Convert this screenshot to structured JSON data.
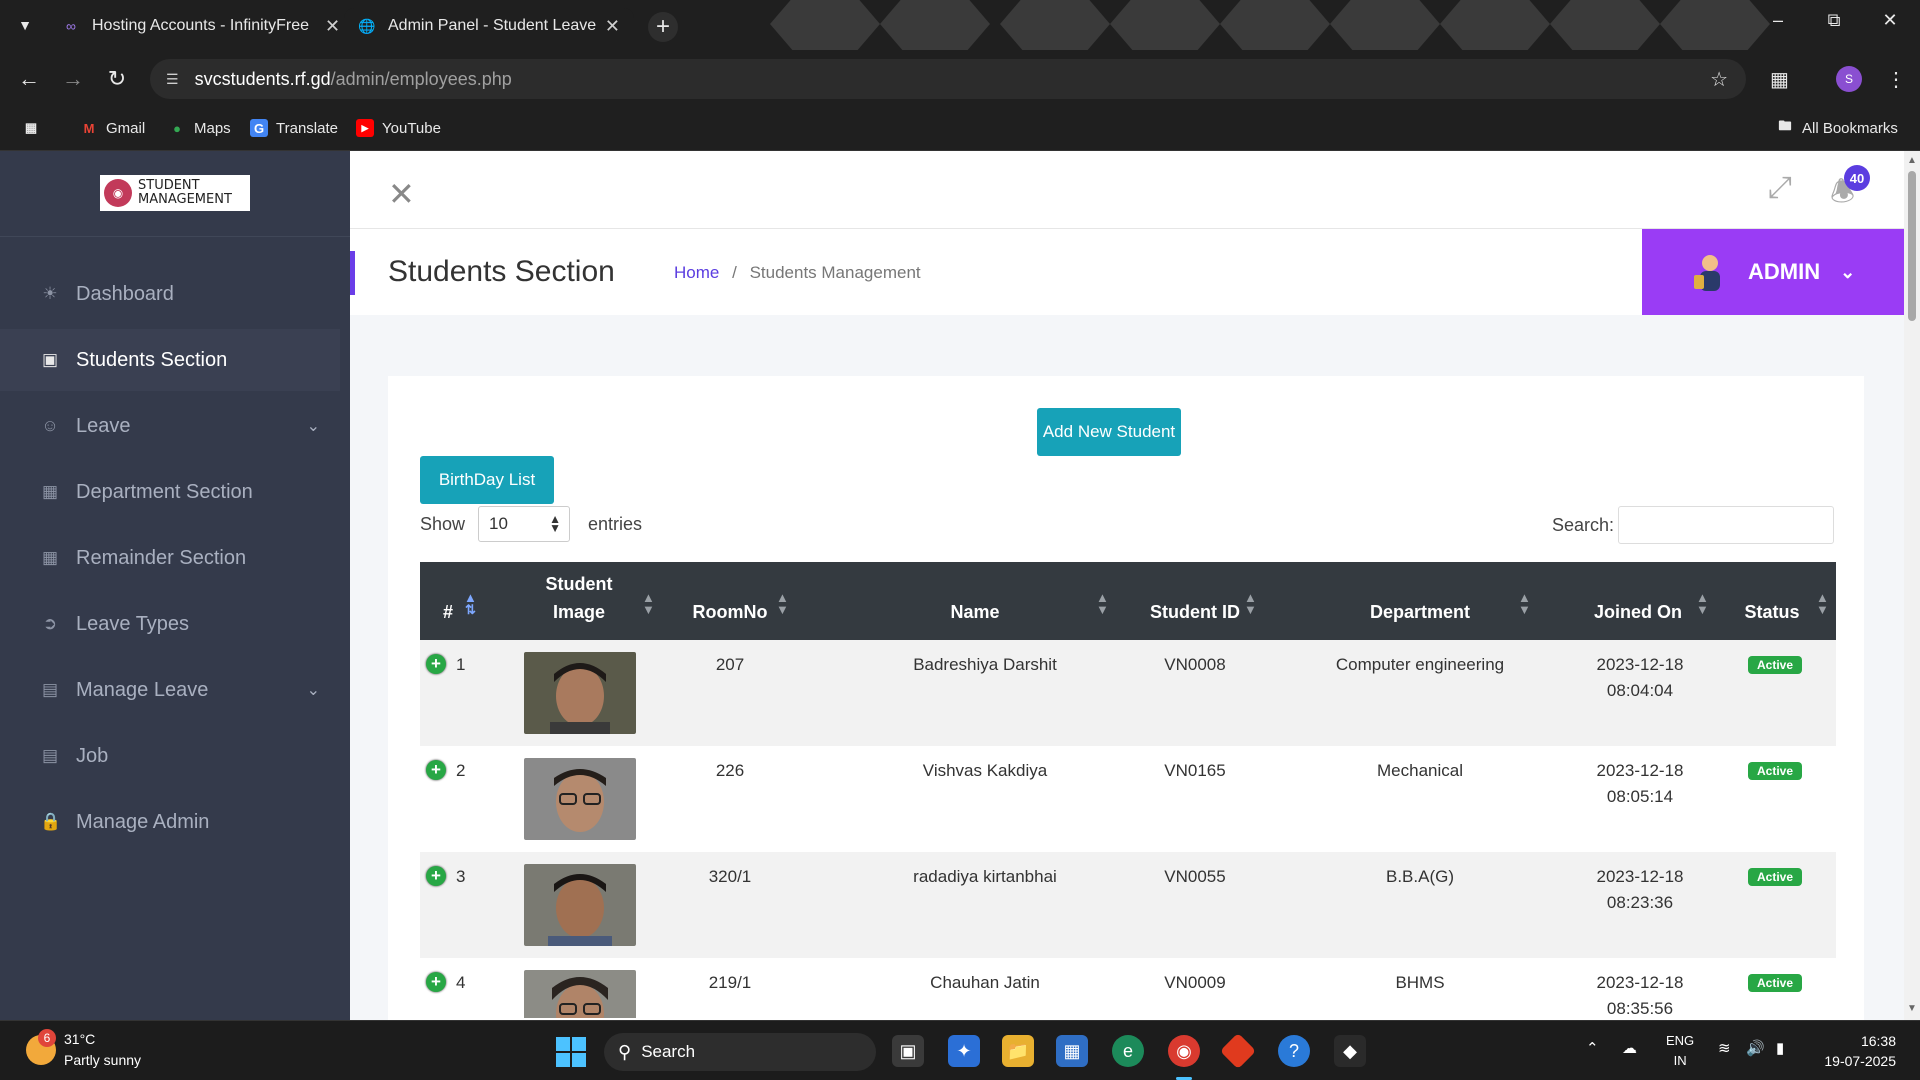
{
  "browser": {
    "tabs": [
      {
        "title": "Hosting Accounts - InfinityFree"
      },
      {
        "title": "Admin Panel - Student Leave"
      }
    ],
    "url_host": "svcstudents.rf.gd",
    "url_path": "/admin/employees.php",
    "bookmarks": [
      {
        "label": "Gmail"
      },
      {
        "label": "Maps"
      },
      {
        "label": "Translate"
      },
      {
        "label": "YouTube"
      }
    ],
    "all_bookmarks": "All Bookmarks",
    "profile_initial": "S"
  },
  "sidebar": {
    "logo_line1": "STUDENT",
    "logo_line2": "MANAGEMENT",
    "items": [
      {
        "label": "Dashboard",
        "icon": "palette-icon"
      },
      {
        "label": "Students Section",
        "icon": "id-card-icon"
      },
      {
        "label": "Leave",
        "icon": "user-icon"
      },
      {
        "label": "Department Section",
        "icon": "grid-icon"
      },
      {
        "label": "Remainder Section",
        "icon": "calendar-icon"
      },
      {
        "label": "Leave Types",
        "icon": "sign-out-icon"
      },
      {
        "label": "Manage Leave",
        "icon": "briefcase-icon"
      },
      {
        "label": "Job",
        "icon": "briefcase-icon"
      },
      {
        "label": "Manage Admin",
        "icon": "lock-icon"
      }
    ]
  },
  "topnav": {
    "notification_count": "40"
  },
  "header": {
    "title": "Students Section",
    "breadcrumb_home": "Home",
    "breadcrumb_sep": "/",
    "breadcrumb_current": "Students Management",
    "admin_label": "ADMIN"
  },
  "controls": {
    "add_student": "Add New Student",
    "birthday_list": "BirthDay List",
    "show_label": "Show",
    "entries_value": "10",
    "entries_label": "entries",
    "search_label": "Search:"
  },
  "table": {
    "columns": [
      "#",
      "Student Image",
      "RoomNo",
      "Name",
      "Student ID",
      "Department",
      "Joined On",
      "Status"
    ],
    "rows": [
      {
        "num": "1",
        "room": "207",
        "name": "Badreshiya  Darshit",
        "id": "VN0008",
        "dept": "Computer engineering",
        "date": "2023-12-18",
        "time": "08:04:04",
        "status": "Active"
      },
      {
        "num": "2",
        "room": "226",
        "name": "Vishvas Kakdiya",
        "id": "VN0165",
        "dept": "Mechanical",
        "date": "2023-12-18",
        "time": "08:05:14",
        "status": "Active"
      },
      {
        "num": "3",
        "room": "320/1",
        "name": "radadiya kirtanbhai",
        "id": "VN0055",
        "dept": "B.B.A(G)",
        "date": "2023-12-18",
        "time": "08:23:36",
        "status": "Active"
      },
      {
        "num": "4",
        "room": "219/1",
        "name": "Chauhan  Jatin",
        "id": "VN0009",
        "dept": "BHMS",
        "date": "2023-12-18",
        "time": "08:35:56",
        "status": "Active"
      }
    ]
  },
  "taskbar": {
    "weather_badge": "6",
    "temperature": "31°C",
    "weather": "Partly sunny",
    "search_label": "Search",
    "lang1": "ENG",
    "lang2": "IN",
    "time": "16:38",
    "date": "19-07-2025"
  },
  "colors": {
    "sidebar_bg": "#343a4b",
    "admin_bg": "#9a3cf5",
    "button_teal": "#17a2b8",
    "table_head": "#343a40",
    "status_green": "#28a745"
  }
}
